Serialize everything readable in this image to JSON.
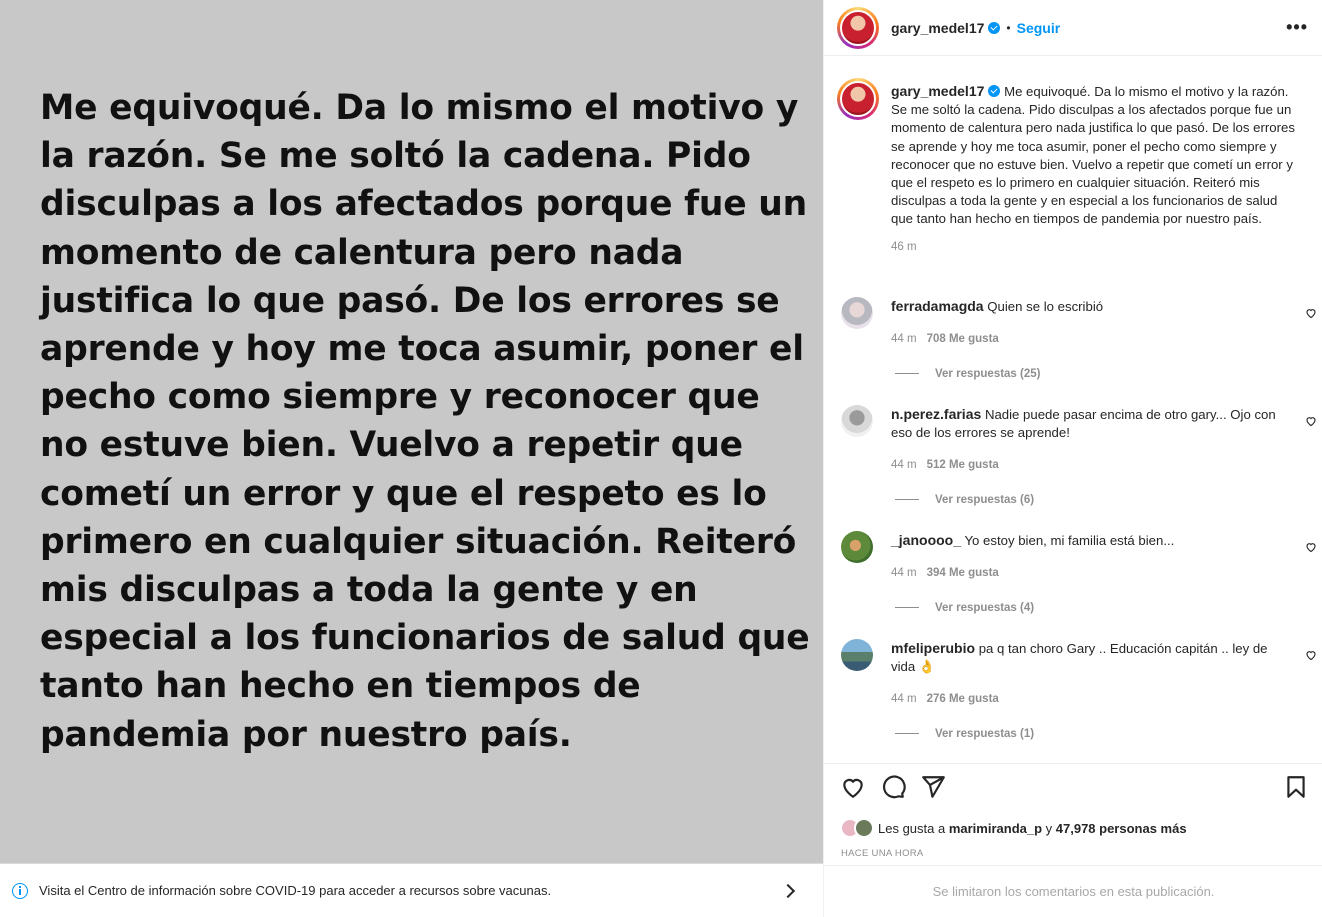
{
  "post": {
    "image_text": "Me equivoqué. Da lo mismo el motivo y la razón. Se me soltó la cadena. Pido disculpas a los afectados porque fue un momento de calentura pero nada justifica lo que pasó. De los errores se aprende y hoy me toca asumir, poner el pecho como siempre y reconocer que no estuve bien. Vuelvo a repetir que cometí un error y que el respeto es lo primero en cualquier situación. Reiteró mis disculpas a toda la gente y en especial a los funcionarios de salud que tanto han hecho en tiempos de pandemia por nuestro país.",
    "background_color": "#c8c8c8"
  },
  "covid_banner": {
    "text": "Visita el Centro de información sobre COVID-19 para acceder a recursos sobre vacunas."
  },
  "header": {
    "username": "gary_medel17",
    "separator": "•",
    "follow_label": "Seguir",
    "more_label": "•••"
  },
  "caption": {
    "username": "gary_medel17",
    "text": "Me equivoqué. Da lo mismo el motivo y la razón. Se me soltó la cadena. Pido disculpas a los afectados porque fue un momento de calentura pero nada justifica lo que pasó. De los errores se aprende y hoy me toca asumir, poner el pecho como siempre y reconocer que no estuve bien. Vuelvo a repetir que cometí un error y que el respeto es lo primero en cualquier situación. Reiteró mis disculpas a toda la gente y en especial a los funcionarios de salud que tanto han hecho en tiempos de pandemia por nuestro país.",
    "time": "46 m"
  },
  "comments": [
    {
      "username": "ferradamagda",
      "text": "Quien se lo escribió",
      "time": "44 m",
      "likes": "708 Me gusta",
      "replies": "Ver respuestas (25)"
    },
    {
      "username": "n.perez.farias",
      "text": "Nadie puede pasar encima de otro gary... Ojo con eso de los errores se aprende!",
      "time": "44 m",
      "likes": "512 Me gusta",
      "replies": "Ver respuestas (6)"
    },
    {
      "username": "_janoooo_",
      "text": " Yo estoy bien, mi familia está bien...",
      "time": "44 m",
      "likes": "394 Me gusta",
      "replies": "Ver respuestas (4)"
    },
    {
      "username": "mfeliperubio",
      "text": "pa q tan choro Gary .. Educación capitán .. ley de vida 👌",
      "time": "44 m",
      "likes": "276 Me gusta",
      "replies": "Ver respuestas (1)"
    }
  ],
  "likes": {
    "prefix": "Les gusta a ",
    "user": "marimiranda_p",
    "middle": " y ",
    "count": "47,978 personas más"
  },
  "timeago": "HACE UNA HORA",
  "comments_limited": "Se limitaron los comentarios en esta publicación.",
  "icons": [
    "info-icon",
    "chevron-right-icon",
    "verified-icon",
    "more-icon",
    "heart-icon",
    "comment-icon",
    "share-icon",
    "bookmark-icon"
  ],
  "colors": {
    "link": "#0095f6",
    "muted": "#8e8e8e",
    "text": "#262626"
  }
}
